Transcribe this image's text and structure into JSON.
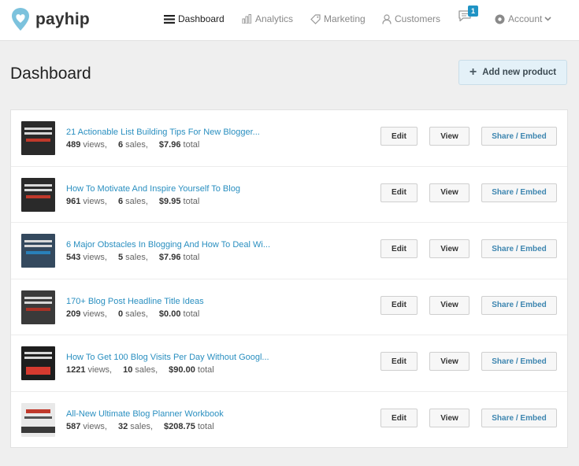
{
  "brand": {
    "name": "payhip"
  },
  "nav": [
    {
      "label": "Dashboard",
      "icon": "menu-icon",
      "active": true
    },
    {
      "label": "Analytics",
      "icon": "bar-chart-icon",
      "active": false
    },
    {
      "label": "Marketing",
      "icon": "tag-icon",
      "active": false
    },
    {
      "label": "Customers",
      "icon": "user-icon",
      "active": false
    }
  ],
  "notifications": {
    "count": "1",
    "icon": "chat-icon"
  },
  "account": {
    "label": "Account",
    "icon": "gear-icon"
  },
  "page": {
    "title": "Dashboard"
  },
  "add_button": {
    "label": "Add new product",
    "icon": "plus-icon"
  },
  "colors": {
    "link": "#2a8fc0",
    "accent": "#1f93c4",
    "add_bg": "#e4f1f8"
  },
  "products": [
    {
      "title": "21 Actionable List Building Tips For New Blogger...",
      "views": "489",
      "sales": "6",
      "total": "$7.96"
    },
    {
      "title": "How To Motivate And Inspire Yourself To Blog",
      "views": "961",
      "sales": "6",
      "total": "$9.95"
    },
    {
      "title": "6 Major Obstacles In Blogging And How To Deal Wi...",
      "views": "543",
      "sales": "5",
      "total": "$7.96"
    },
    {
      "title": "170+ Blog Post Headline Title Ideas",
      "views": "209",
      "sales": "0",
      "total": "$0.00"
    },
    {
      "title": "How To Get 100 Blog Visits Per Day Without Googl...",
      "views": "1221",
      "sales": "10",
      "total": "$90.00"
    },
    {
      "title": "All-New Ultimate Blog Planner Workbook",
      "views": "587",
      "sales": "32",
      "total": "$208.75"
    }
  ],
  "row_labels": {
    "views": "views,",
    "sales": "sales,",
    "total": "total",
    "edit": "Edit",
    "view": "View",
    "share": "Share / Embed"
  }
}
